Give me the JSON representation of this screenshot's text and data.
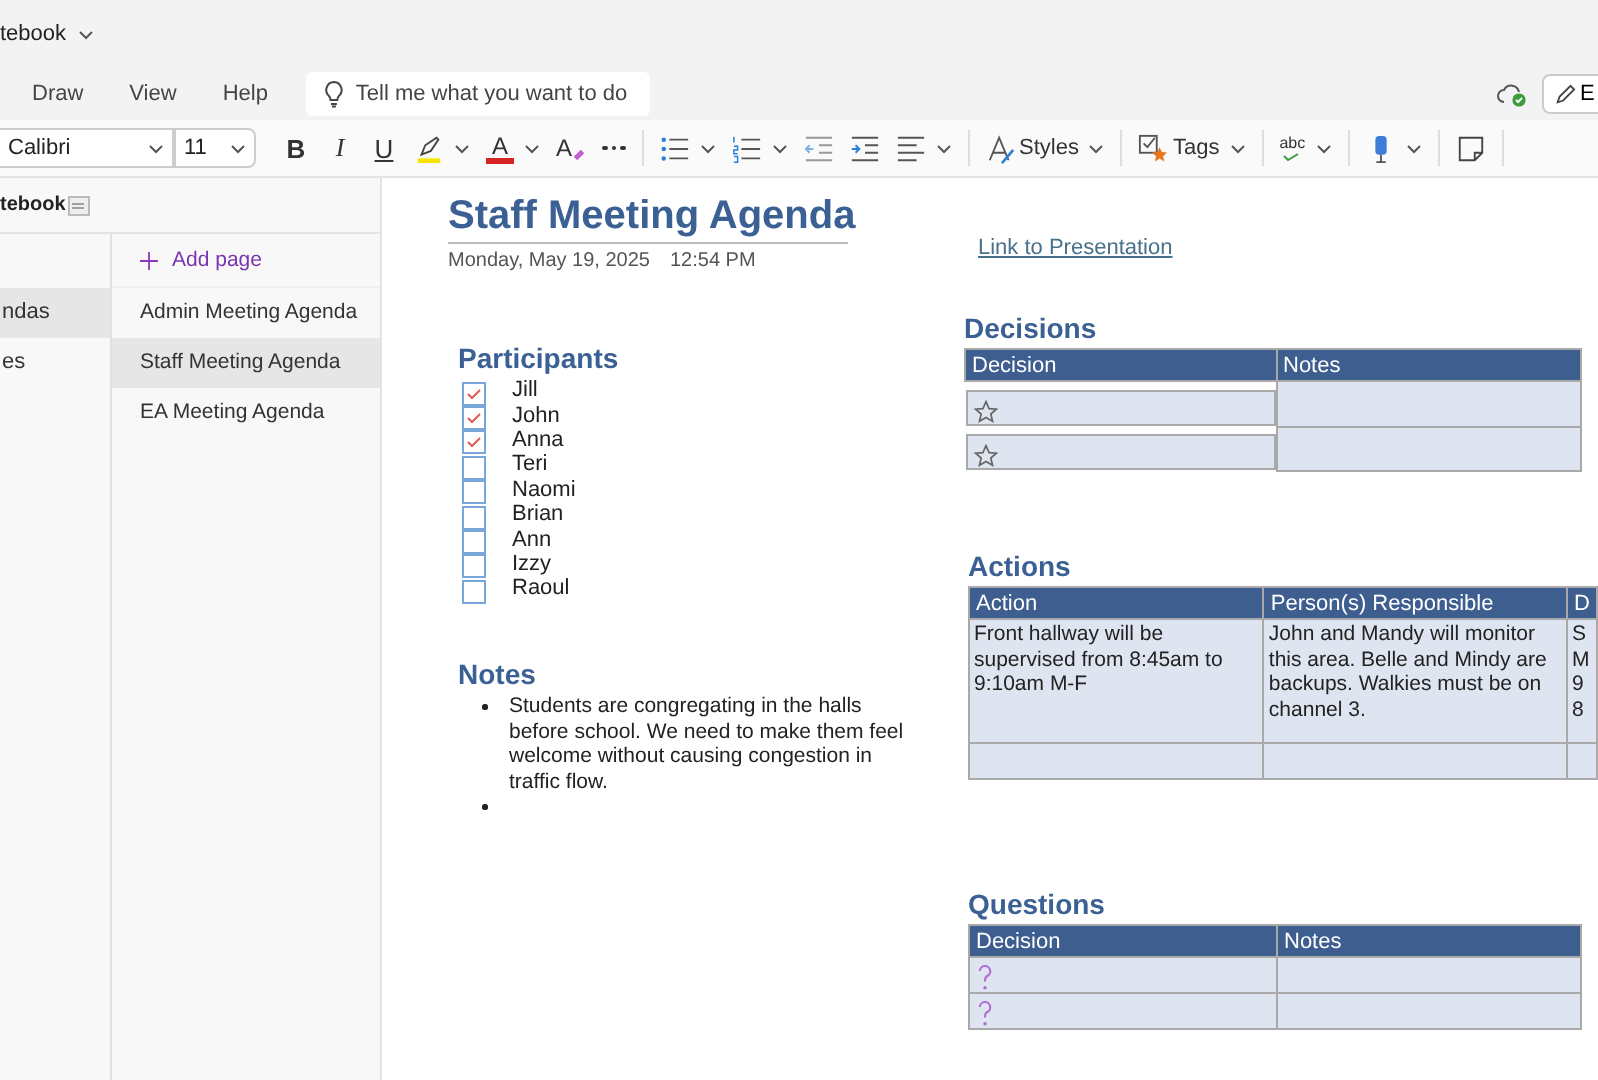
{
  "title_bar": {
    "notebook": "tebook"
  },
  "menu": {
    "tabs": [
      "Draw",
      "View",
      "Help"
    ],
    "search": {
      "placeholder": "Tell me what you want to do"
    },
    "edit_button": "E"
  },
  "toolbar": [
    {
      "kind": "font",
      "text": "Calibri"
    },
    {
      "kind": "size",
      "text": "11"
    },
    {
      "kind": "bold",
      "text": "B"
    },
    {
      "kind": "italic",
      "text": "I"
    },
    {
      "kind": "underline",
      "text": "U"
    },
    {
      "kind": "highlight"
    },
    {
      "kind": "font-color",
      "text": "A"
    },
    {
      "kind": "clear-format",
      "text": "A"
    },
    {
      "kind": "more"
    },
    {
      "kind": "divider"
    },
    {
      "kind": "bullets"
    },
    {
      "kind": "numbering"
    },
    {
      "kind": "outdent"
    },
    {
      "kind": "indent"
    },
    {
      "kind": "align"
    },
    {
      "kind": "divider"
    },
    {
      "kind": "styles",
      "text": "Styles"
    },
    {
      "kind": "divider"
    },
    {
      "kind": "tags",
      "text": "Tags"
    },
    {
      "kind": "divider"
    },
    {
      "kind": "spelling",
      "text": "abc"
    },
    {
      "kind": "divider"
    },
    {
      "kind": "dictate"
    },
    {
      "kind": "divider"
    },
    {
      "kind": "sticky-note"
    },
    {
      "kind": "divider"
    }
  ],
  "navigation": {
    "notebook": "tebook",
    "sections": [
      {
        "label": "ndas",
        "selected": true
      },
      {
        "label": "es",
        "selected": false
      }
    ],
    "add_page": "Add page",
    "pages": [
      {
        "label": "Admin Meeting Agenda",
        "selected": false
      },
      {
        "label": "Staff Meeting Agenda",
        "selected": true
      },
      {
        "label": "EA Meeting Agenda",
        "selected": false
      }
    ]
  },
  "page": {
    "title": "Staff Meeting Agenda",
    "date": "Monday, May 19, 2025",
    "time": "12:54 PM",
    "link": "Link to Presentation",
    "participants": {
      "heading": "Participants",
      "items": [
        {
          "name": "Jill",
          "checked": true
        },
        {
          "name": "John",
          "checked": true
        },
        {
          "name": "Anna",
          "checked": true
        },
        {
          "name": "Teri",
          "checked": false
        },
        {
          "name": "Naomi",
          "checked": false
        },
        {
          "name": "Brian",
          "checked": false
        },
        {
          "name": "Ann",
          "checked": false
        },
        {
          "name": "Izzy",
          "checked": false
        },
        {
          "name": "Raoul",
          "checked": false
        }
      ]
    },
    "notes": {
      "heading": "Notes",
      "bullets": [
        {
          "kind": "text",
          "text": "Students are congregating in the halls before school. We need to make them feel welcome without causing congestion in traffic flow."
        },
        {
          "kind": "empty"
        }
      ]
    },
    "tables": [
      {
        "heading": "Decisions",
        "columns": [
          "Decision",
          "Notes"
        ],
        "rows": [
          {
            "cells": [
              {
                "kind": "star"
              },
              {
                "kind": "blank"
              }
            ]
          },
          {
            "cells": [
              {
                "kind": "star"
              },
              {
                "kind": "blank"
              }
            ]
          }
        ]
      },
      {
        "heading": "Actions",
        "columns": [
          "Action",
          "Person(s) Responsible",
          "D"
        ],
        "rows": [
          {
            "cells": [
              {
                "kind": "text",
                "text": "Front hallway will be supervised from 8:45am to 9:10am M-F"
              },
              {
                "kind": "text",
                "text": "John and Mandy will monitor this area. Belle and Mindy are backups. Walkies must be on channel 3."
              },
              {
                "kind": "text",
                "text": "S\nM\n9\n8"
              }
            ]
          },
          {
            "cells": [
              {
                "kind": "blank"
              },
              {
                "kind": "blank"
              },
              {
                "kind": "blank"
              }
            ]
          }
        ]
      },
      {
        "heading": "Questions",
        "columns": [
          "Decision",
          "Notes"
        ],
        "rows": [
          {
            "cells": [
              {
                "kind": "question"
              },
              {
                "kind": "blank"
              }
            ]
          },
          {
            "cells": [
              {
                "kind": "question"
              },
              {
                "kind": "blank"
              }
            ]
          }
        ]
      }
    ]
  }
}
